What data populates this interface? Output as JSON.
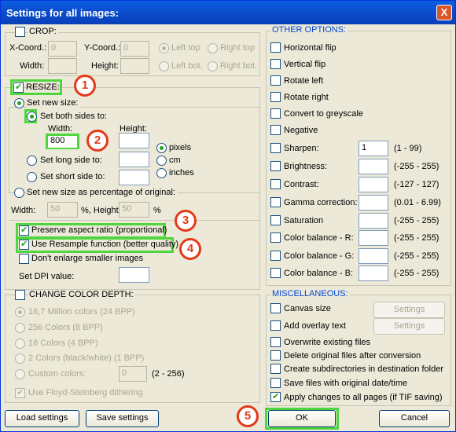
{
  "window": {
    "title": "Settings for all images:",
    "close": "X"
  },
  "crop": {
    "label": "CROP:",
    "x_label": "X-Coord.:",
    "x_value": "0",
    "y_label": "Y-Coord.:",
    "y_value": "0",
    "w_label": "Width:",
    "h_label": "Height:",
    "left_top": "Left top",
    "right_top": "Right top",
    "left_bot": "Left bot.",
    "right_bot": "Right bot."
  },
  "resize": {
    "label": "RESIZE:",
    "set_new_size": "Set new size:",
    "both_sides": "Set both sides to:",
    "width_label": "Width:",
    "height_label": "Height:",
    "width_value": "800",
    "pixels": "pixels",
    "cm": "cm",
    "inches": "inches",
    "long_side": "Set long side to:",
    "short_side": "Set short side to:",
    "percentage": "Set new size as percentage of original:",
    "pct_width_label": "Width:",
    "pct_width_value": "50",
    "pct_height_label": "%, Height:",
    "pct_height_value": "50",
    "pct_unit": "%",
    "preserve": "Preserve aspect ratio (proportional)",
    "resample": "Use Resample function (better quality)",
    "dont_enlarge": "Don't enlarge smaller images",
    "dpi_label": "Set DPI value:"
  },
  "color_depth": {
    "label": "CHANGE COLOR DEPTH:",
    "options": [
      "16,7 Million colors (24 BPP)",
      "256 Colors (8 BPP)",
      "16 Colors (4 BPP)",
      "2 Colors (black/white) (1 BPP)",
      "Custom colors:"
    ],
    "custom_value": "0",
    "custom_range": "(2 - 256)",
    "dithering": "Use Floyd-Steinberg dithering"
  },
  "other": {
    "label": "OTHER OPTIONS:",
    "horizontal_flip": "Horizontal flip",
    "vertical_flip": "Vertical flip",
    "rotate_left": "Rotate left",
    "rotate_right": "Rotate right",
    "greyscale": "Convert to greyscale",
    "negative": "Negative",
    "sharpen": "Sharpen:",
    "sharpen_value": "1",
    "sharpen_range": "(1  -  99)",
    "brightness": "Brightness:",
    "brightness_range": "(-255  -  255)",
    "contrast": "Contrast:",
    "contrast_range": "(-127  -  127)",
    "gamma": "Gamma correction:",
    "gamma_range": "(0.01  -  6.99)",
    "saturation": "Saturation",
    "saturation_range": "(-255  -  255)",
    "cb_r": "Color balance - R:",
    "cb_r_range": "(-255  -  255)",
    "cb_g": "Color balance - G:",
    "cb_g_range": "(-255  -  255)",
    "cb_b": "Color balance - B:",
    "cb_b_range": "(-255  -  255)"
  },
  "misc": {
    "label": "MISCELLANEOUS:",
    "canvas_size": "Canvas size",
    "overlay_text": "Add overlay text",
    "settings_btn": "Settings",
    "overwrite": "Overwrite existing files",
    "delete_orig": "Delete original files after conversion",
    "subdirs": "Create subdirectories in destination folder",
    "save_date": "Save files with original date/time",
    "apply_pages": "Apply changes to all pages (if TIF saving)"
  },
  "buttons": {
    "load": "Load settings",
    "save": "Save settings",
    "ok": "OK",
    "cancel": "Cancel"
  },
  "badges": [
    "1",
    "2",
    "3",
    "4",
    "5"
  ],
  "colors": {
    "title_bar": "#0b4fd0",
    "group_title": "#0046d5",
    "highlight": "#4fd63e",
    "badge": "#e23a1a"
  }
}
